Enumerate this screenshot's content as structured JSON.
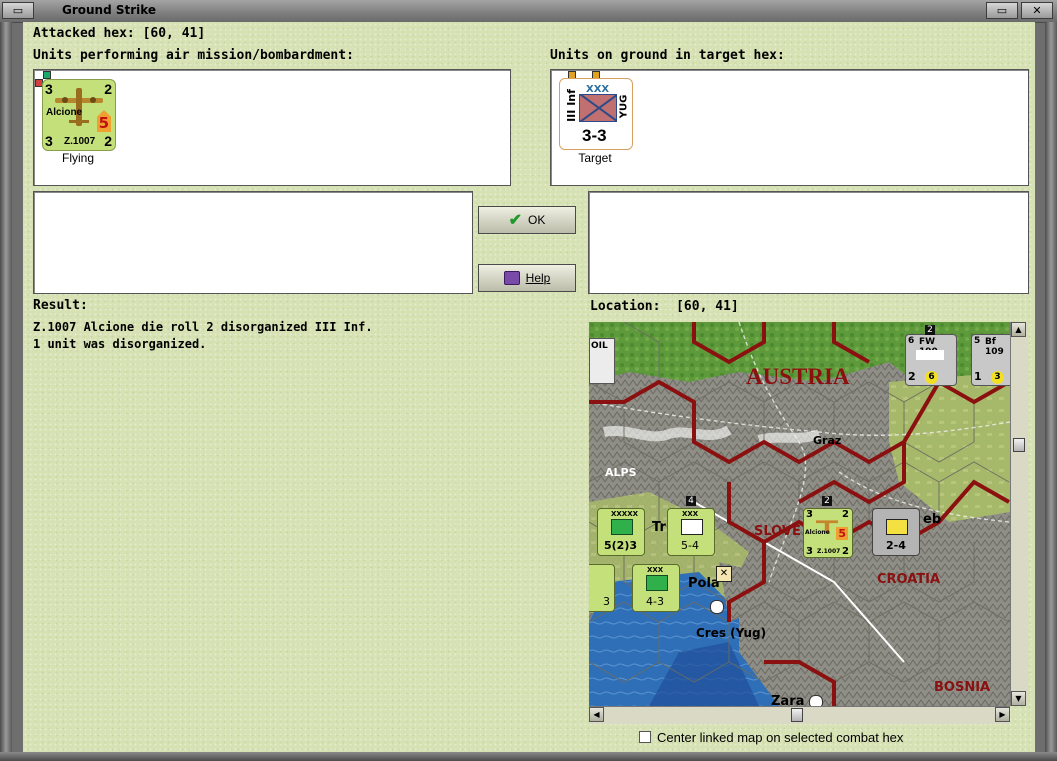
{
  "window": {
    "title": "Ground Strike"
  },
  "attacked_hex": {
    "label": "Attacked hex:",
    "value": "[60, 41]"
  },
  "air_units": {
    "header": "Units performing air mission/bombardment:",
    "unit": {
      "name": "Alcione",
      "type": "Z.1007",
      "top_left": "3",
      "top_right": "2",
      "bottom_left": "3",
      "bottom_right": "2",
      "range": "5",
      "status": "Flying"
    }
  },
  "ground_units": {
    "header": "Units on ground in target hex:",
    "unit": {
      "size": "XXX",
      "name": "III Inf",
      "nation": "YUG",
      "strength": "3-3",
      "status": "Target"
    }
  },
  "buttons": {
    "ok": "OK",
    "help": "Help"
  },
  "result": {
    "label": "Result:",
    "lines": [
      "Z.1007 Alcione die roll 2 disorganized III Inf.",
      "1 unit was disorganized."
    ]
  },
  "location": {
    "label": "Location:",
    "value": "[60, 41]"
  },
  "map": {
    "labels": {
      "austria": "AUSTRIA",
      "graz": "Graz",
      "alps": "ALPS",
      "slove": "SLOVE",
      "croatia": "CROATIA",
      "pola": "Pola",
      "cres": "Cres (Yug)",
      "bosnia": "BOSNIA",
      "zara": "Zara",
      "tr": "Tr",
      "eb": "eb",
      "oil": "OIL"
    },
    "counters": {
      "fw190": {
        "name": "FW 190",
        "a": "6",
        "b": "2",
        "c": "6",
        "stack": "2"
      },
      "bf109": {
        "name": "Bf 109",
        "a": "5",
        "b": "1",
        "c": "3"
      },
      "armor": {
        "size": "XXXXX",
        "val": "5(2)3"
      },
      "inf_a": {
        "size": "XXX",
        "val": "5-4",
        "stack": "4"
      },
      "air": {
        "name": "Alcione",
        "type": "Z.1007",
        "tl": "3",
        "tr": "2",
        "bl": "3",
        "br": "2",
        "rng": "5",
        "stack": "2"
      },
      "yug": {
        "size": "XXX",
        "val": "2-4"
      },
      "inf_b": {
        "size": "XXX",
        "val": "4-3"
      },
      "partial": {
        "val": "3"
      }
    }
  },
  "center_option": {
    "label": "Center linked map on selected combat hex",
    "checked": false
  },
  "colors": {
    "panel_bg": "#d6e2b4",
    "counter_green": "#c4e07a",
    "sea": "#2f6fb8",
    "border_red": "#8b1010"
  }
}
